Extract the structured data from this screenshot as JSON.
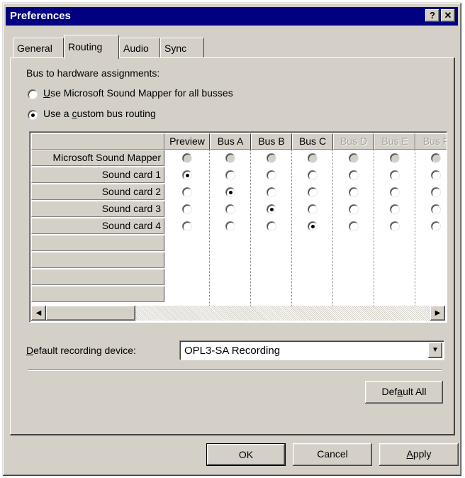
{
  "window": {
    "title": "Preferences"
  },
  "title_buttons": {
    "help": "?",
    "close": "✕"
  },
  "tabs": [
    {
      "label": "General"
    },
    {
      "label": "Routing"
    },
    {
      "label": "Audio"
    },
    {
      "label": "Sync"
    }
  ],
  "routing": {
    "section_label": "Bus to hardware assignments:",
    "option_mapper": {
      "prefix": "",
      "key": "U",
      "rest": "se Microsoft Sound Mapper for all busses",
      "selected": false
    },
    "option_custom": {
      "prefix": "Use a ",
      "key": "c",
      "rest": "ustom bus routing",
      "selected": true
    },
    "grid": {
      "columns": [
        {
          "label": "Preview",
          "enabled": true
        },
        {
          "label": "Bus A",
          "enabled": true
        },
        {
          "label": "Bus B",
          "enabled": true
        },
        {
          "label": "Bus C",
          "enabled": true
        },
        {
          "label": "Bus D",
          "enabled": false
        },
        {
          "label": "Bus E",
          "enabled": false
        },
        {
          "label": "Bus F",
          "enabled": false
        }
      ],
      "rows": [
        {
          "label": "Microsoft Sound Mapper",
          "selected_col": -1
        },
        {
          "label": "Sound card 1",
          "selected_col": 0
        },
        {
          "label": "Sound card 2",
          "selected_col": 1
        },
        {
          "label": "Sound card 3",
          "selected_col": 2
        },
        {
          "label": "Sound card 4",
          "selected_col": 3
        },
        {
          "label": "",
          "selected_col": -1
        },
        {
          "label": "",
          "selected_col": -1
        },
        {
          "label": "",
          "selected_col": -1
        },
        {
          "label": "",
          "selected_col": -1
        }
      ]
    },
    "recording": {
      "label_key": "D",
      "label_rest": "efault recording device:",
      "value": "OPL3-SA Recording"
    },
    "default_all": {
      "prefix": "Def",
      "key": "a",
      "rest": "ult All"
    }
  },
  "footer": {
    "ok": "OK",
    "cancel": "Cancel",
    "apply_key": "A",
    "apply_rest": "pply"
  }
}
